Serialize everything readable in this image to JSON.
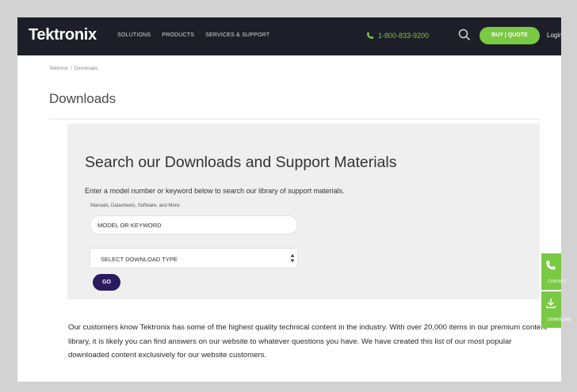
{
  "header": {
    "logo": "Tektronix",
    "nav": [
      "SOLUTIONS",
      "PRODUCTS",
      "SERVICES & SUPPORT"
    ],
    "phone": "1-800-833-9200",
    "buy_quote_label": "BUY | QUOTE",
    "login_label": "Login"
  },
  "breadcrumb": [
    "Tektronix",
    "/",
    "Downloads"
  ],
  "page_title": "Downloads",
  "search": {
    "heading": "Search our Downloads and Support Materials",
    "description": "Enter a model number or keyword below to search our library of support materials.",
    "small_label": "Manuals, Datasheets, Software, and More:",
    "input_placeholder": "MODEL OR KEYWORD",
    "select_value": "SELECT DOWNLOAD TYPE",
    "go_label": "GO"
  },
  "body_text": "Our customers know Tektronix has some of the highest quality technical content in the industry. With over 20,000 items in our premium content library, it is likely you can find answers on our website to whatever questions you have. We have created this list of our most popular downloaded content exclusively for our website customers.",
  "side_tabs": [
    "CONTACT",
    "DOWNLOAD"
  ],
  "colors": {
    "nav_bg": "#1e1e28",
    "accent_green": "#7ac943",
    "go_button": "#2b1a5c",
    "panel_bg": "#efefef"
  }
}
